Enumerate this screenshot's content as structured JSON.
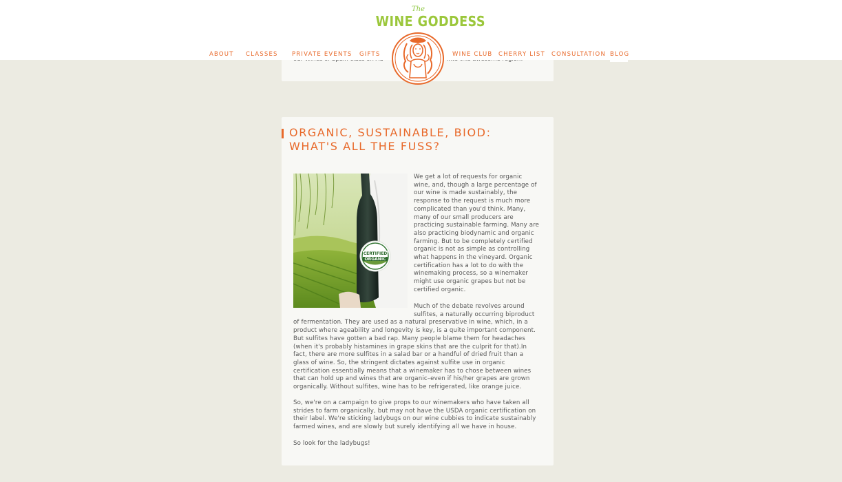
{
  "logo": {
    "the": "The",
    "name": "WINE GODDESS",
    "reg": "®"
  },
  "nav": {
    "about": "ABOUT",
    "classes": "CLASSES",
    "private_events": "PRIVATE EVENTS",
    "gifts": "GIFTS",
    "wine_club": "WINE CLUB",
    "cherry_list": "CHERRY LIST",
    "consultation": "CONSULTATION",
    "blog": "BLOG"
  },
  "prev_post": {
    "snippet_left": "our Wines of Spain class on Au",
    "snippet_right": "into this awesome region!"
  },
  "post": {
    "title_line1": "ORGANIC, SUSTAINABLE, BIOD:",
    "title_line2": "WHAT'S ALL THE FUSS?",
    "image_badge_line1": "CERTIFIED",
    "image_badge_line2": "ORGANIC",
    "para1": [
      "We get a lot of requests for organic",
      "wine, and, though a large percentage of",
      "our wine is made sustainably, the",
      "response to the request is much more",
      "complicated than you'd think. Many,",
      "many of our small producers are",
      "practicing sustainable farming. Many are",
      "also practicing biodynamic and organic",
      "farming. But to be completely certified",
      "organic is not as simple as controlling",
      "what happens in the vineyard. Organic",
      "certification has a lot to do with the",
      "winemaking process, so a winemaker",
      "might use organic grapes but not be",
      "certified organic."
    ],
    "para2": [
      "Much of the debate revolves around",
      "sulfites, a naturally occurring biproduct",
      "of fermentation. They are used as a natural preservative in wine, which, in a",
      "product where ageability and longevity is key, is a quite important component.",
      "But sulfites have gotten a bad rap. Many people blame them for headaches",
      "(when it's probably histamines in grape skins that are the culprit for that).In",
      "fact, there are more sulfites in a salad bar or a handful of dried fruit than a",
      "glass of wine. So, the stringent dictates against sulfite use in organic",
      "certification essentially means that a winemaker has to chose between wines",
      "that can hold up and wines that are organic–even if his/her grapes are grown",
      "organically. Without sulfites, wine has to be refrigerated, like orange juice."
    ],
    "para3": [
      "So, we're on a campaign to give props to our winemakers who have taken all",
      "strides to farm organically, but may not have the USDA organic certification on",
      "their label. We're sticking ladybugs on our wine cubbies to indicate sustainably",
      "farmed wines, and are slowly but surely identifying all we have in house."
    ],
    "para4": "So look for the ladybugs!"
  },
  "colors": {
    "accent_orange": "#e8692a",
    "logo_green": "#9bc73b",
    "background": "#ecebe2",
    "card": "#f8f8f5"
  }
}
